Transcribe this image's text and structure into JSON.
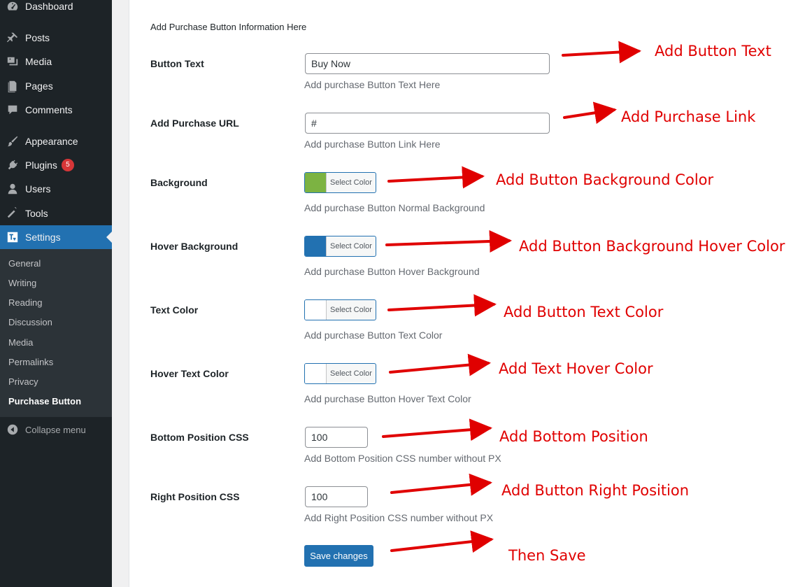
{
  "sidebar": {
    "items": [
      {
        "label": "Dashboard",
        "icon": "dashboard-icon"
      },
      {
        "label": "Posts",
        "icon": "pin-icon"
      },
      {
        "label": "Media",
        "icon": "media-icon"
      },
      {
        "label": "Pages",
        "icon": "pages-icon"
      },
      {
        "label": "Comments",
        "icon": "comment-icon"
      },
      {
        "label": "Appearance",
        "icon": "brush-icon"
      },
      {
        "label": "Plugins",
        "icon": "plug-icon",
        "badge": "5"
      },
      {
        "label": "Users",
        "icon": "user-icon"
      },
      {
        "label": "Tools",
        "icon": "wrench-icon"
      },
      {
        "label": "Settings",
        "icon": "settings-icon",
        "active": true
      }
    ],
    "submenu": [
      "General",
      "Writing",
      "Reading",
      "Discussion",
      "Media",
      "Permalinks",
      "Privacy",
      "Purchase Button"
    ],
    "collapse_label": "Collapse menu"
  },
  "form": {
    "section_title": "Add Purchase Button Information Here",
    "button_text": {
      "label": "Button Text",
      "value": "Buy Now",
      "desc": "Add purchase Button Text Here"
    },
    "purchase_url": {
      "label": "Add Purchase URL",
      "value": "#",
      "desc": "Add purchase Button Link Here"
    },
    "background": {
      "label": "Background",
      "button": "Select Color",
      "color": "#7cb342",
      "desc": "Add purchase Button Normal Background"
    },
    "hover_background": {
      "label": "Hover Background",
      "button": "Select Color",
      "color": "#2271b1",
      "desc": "Add purchase Button Hover Background"
    },
    "text_color": {
      "label": "Text Color",
      "button": "Select Color",
      "color": "#ffffff",
      "desc": "Add purchase Button Text Color"
    },
    "hover_text_color": {
      "label": "Hover Text Color",
      "button": "Select Color",
      "color": "#ffffff",
      "desc": "Add purchase Button Hover Text Color"
    },
    "bottom_position": {
      "label": "Bottom Position CSS",
      "value": "100",
      "desc": "Add Bottom Position CSS number without PX"
    },
    "right_position": {
      "label": "Right Position CSS",
      "value": "100",
      "desc": "Add Right Position CSS number without PX"
    },
    "save_label": "Save changes"
  },
  "annotations": {
    "button_text": "Add Button Text",
    "purchase_link": "Add Purchase Link",
    "background": "Add Button Background Color",
    "hover_background": "Add Button Background Hover Color",
    "text_color": "Add Button Text Color",
    "hover_text": "Add Text Hover Color",
    "bottom": "Add Bottom Position",
    "right": "Add Button Right Position",
    "save": "Then Save"
  },
  "colors": {
    "accent": "#2271b1",
    "annotation": "#e00000",
    "sidebar": "#1d2327"
  }
}
